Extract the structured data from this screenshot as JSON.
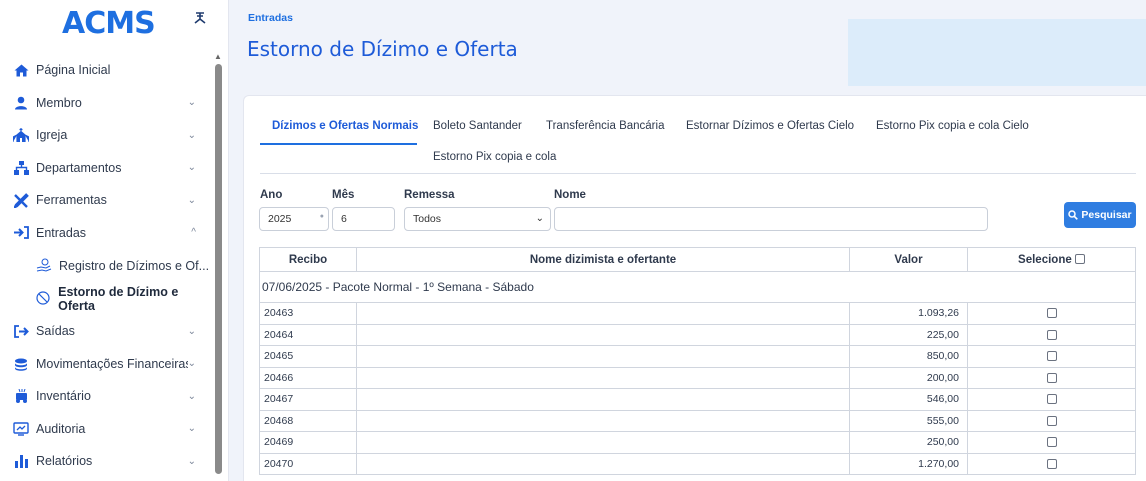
{
  "app": {
    "logo": "ACMS"
  },
  "sidebar": {
    "items": [
      {
        "label": "Página Inicial",
        "icon": "home-icon",
        "chevron": false
      },
      {
        "label": "Membro",
        "icon": "user-icon",
        "chevron": true
      },
      {
        "label": "Igreja",
        "icon": "church-icon",
        "chevron": true
      },
      {
        "label": "Departamentos",
        "icon": "sitemap-icon",
        "chevron": true
      },
      {
        "label": "Ferramentas",
        "icon": "tools-icon",
        "chevron": true
      },
      {
        "label": "Entradas",
        "icon": "sign-in-icon",
        "chevron": true,
        "expanded": true
      }
    ],
    "subitems": [
      {
        "label": "Registro de Dízimos e Of...",
        "icon": "hand-coin-icon"
      },
      {
        "label": "Estorno de Dízimo e Oferta",
        "icon": "ban-icon",
        "active": true
      }
    ],
    "items_after": [
      {
        "label": "Saídas",
        "icon": "sign-out-icon"
      },
      {
        "label": "Movimentações Financeiras",
        "icon": "coins-icon"
      },
      {
        "label": "Inventário",
        "icon": "dolly-icon"
      },
      {
        "label": "Auditoria",
        "icon": "audit-icon"
      },
      {
        "label": "Relatórios",
        "icon": "bar-chart-icon"
      }
    ]
  },
  "header": {
    "breadcrumb": "Entradas",
    "title": "Estorno de Dízimo e Oferta"
  },
  "tabs": [
    "Dízimos e Ofertas Normais",
    "Boleto Santander",
    "Transferência Bancária",
    "Estornar Dízimos e Ofertas Cielo",
    "Estorno Pix copia e cola Cielo",
    "Estorno Pix copia e cola"
  ],
  "filters": {
    "ano_label": "Ano",
    "ano_value": "2025",
    "mes_label": "Mês",
    "mes_value": "6",
    "remessa_label": "Remessa",
    "remessa_value": "Todos",
    "nome_label": "Nome",
    "nome_value": "",
    "search_button": "Pesquisar"
  },
  "table": {
    "headers": {
      "recibo": "Recibo",
      "nome": "Nome dizimista e ofertante",
      "valor": "Valor",
      "selecione": "Selecione"
    },
    "group": "07/06/2025 - Pacote Normal - 1º Semana - Sábado",
    "rows": [
      {
        "recibo": "20463",
        "valor": "1.093,26"
      },
      {
        "recibo": "20464",
        "valor": "225,00"
      },
      {
        "recibo": "20465",
        "valor": "850,00"
      },
      {
        "recibo": "20466",
        "valor": "200,00"
      },
      {
        "recibo": "20467",
        "valor": "546,00"
      },
      {
        "recibo": "20468",
        "valor": "555,00"
      },
      {
        "recibo": "20469",
        "valor": "250,00"
      },
      {
        "recibo": "20470",
        "valor": "1.270,00"
      }
    ]
  },
  "colors": {
    "accent": "#1e6fe0",
    "button": "#2f7de1",
    "header_box": "#dcecfa"
  }
}
